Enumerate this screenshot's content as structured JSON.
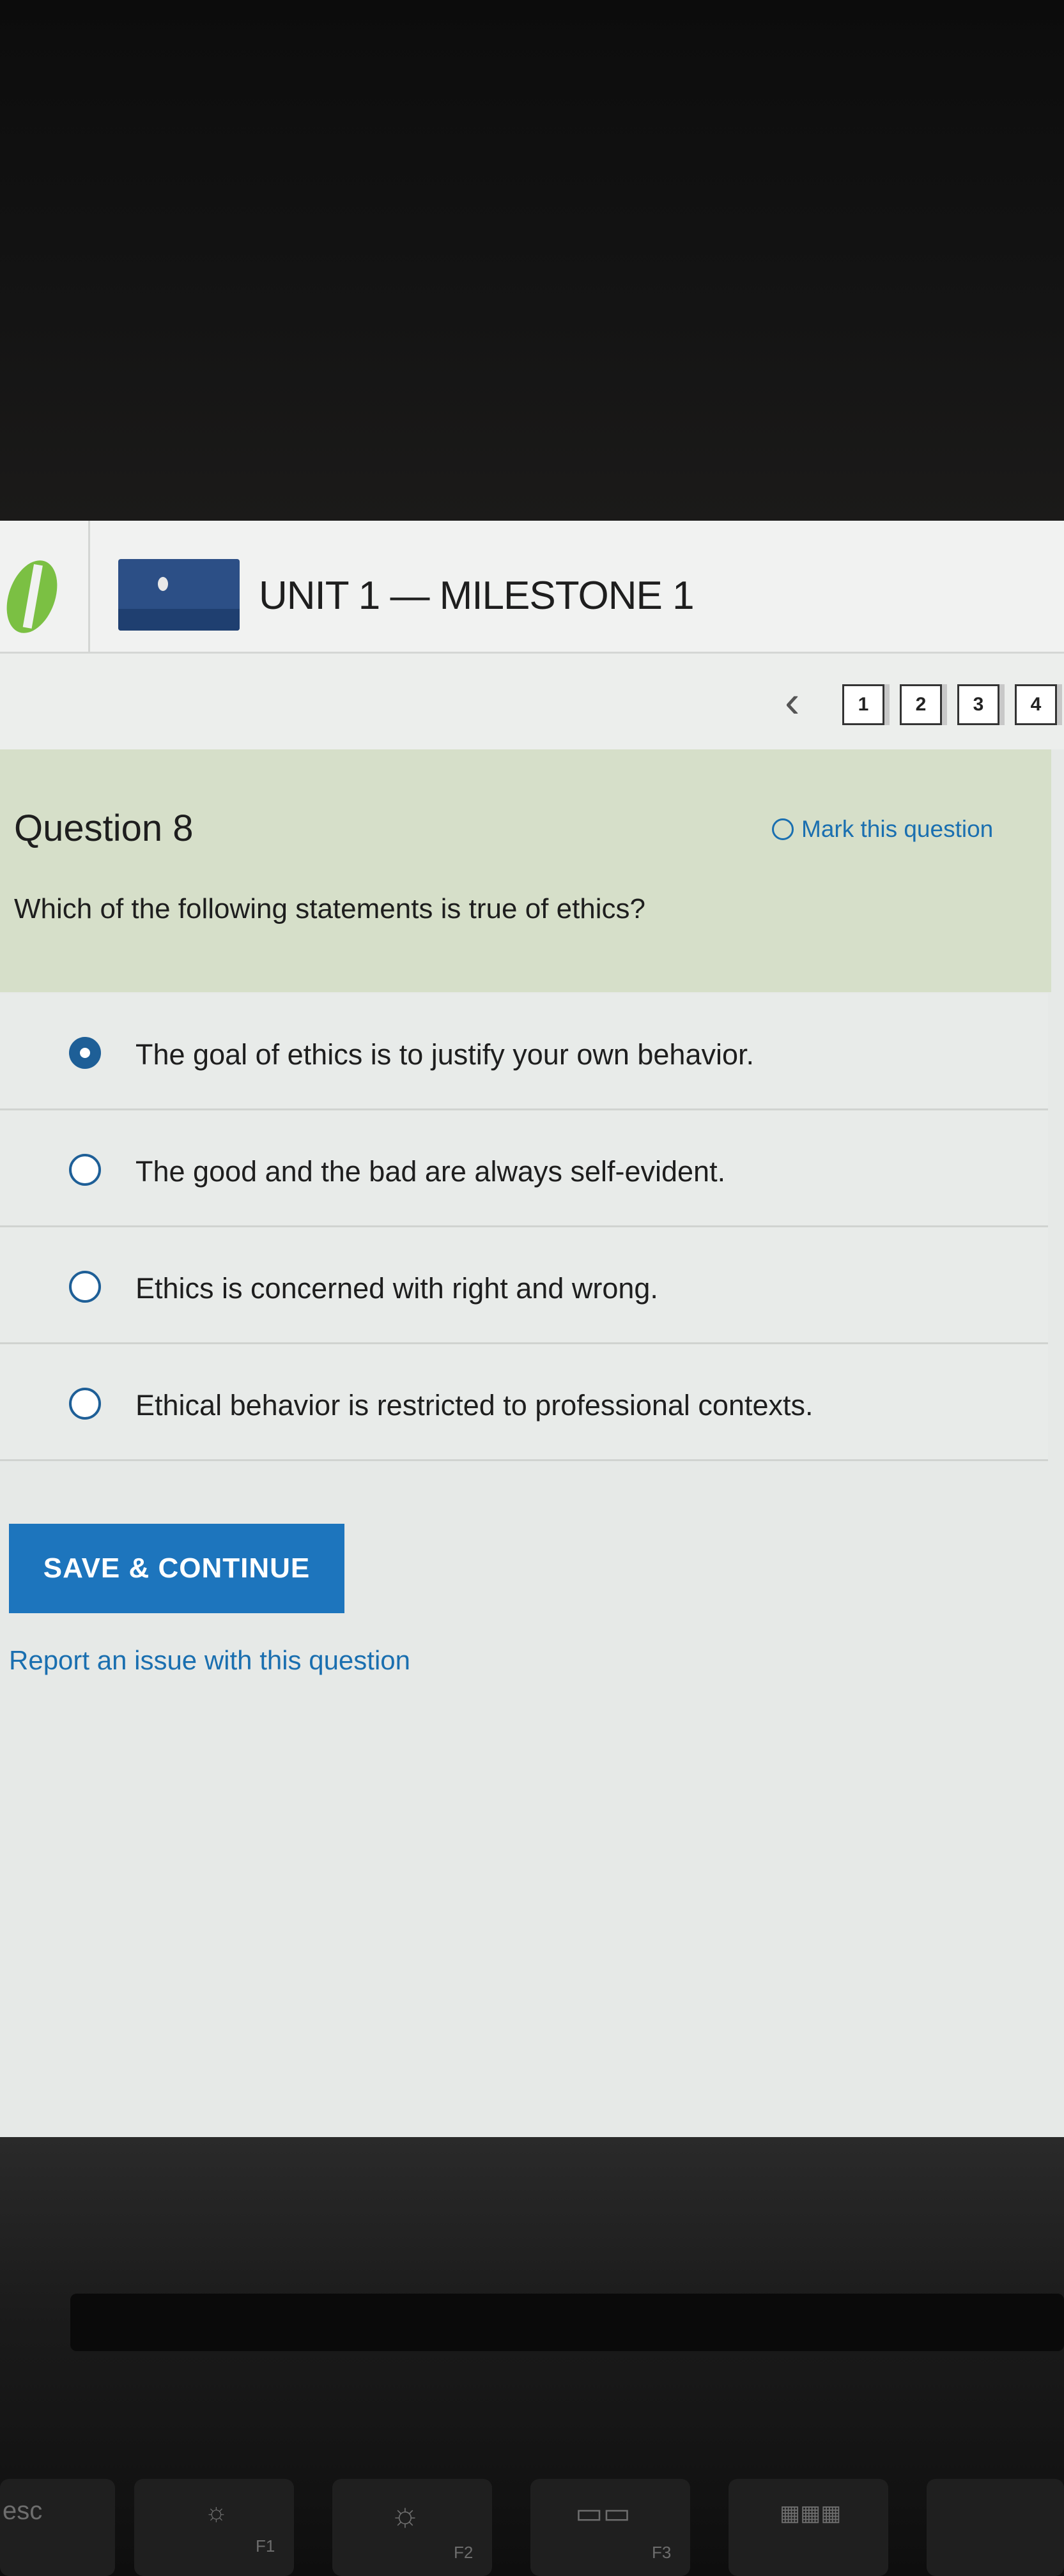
{
  "header": {
    "unit_title": "UNIT 1 — MILESTONE 1"
  },
  "question_nav": {
    "back_icon": "chevron-left-icon",
    "numbers": [
      "1",
      "2",
      "3",
      "4"
    ]
  },
  "question": {
    "number_label": "Question 8",
    "mark_label": "Mark this question",
    "prompt": "Which of the following statements is true of ethics?"
  },
  "answers": [
    {
      "text": "The goal of ethics is to justify your own behavior.",
      "selected": true
    },
    {
      "text": "The good and the bad are always self-evident.",
      "selected": false
    },
    {
      "text": "Ethics is concerned with right and wrong.",
      "selected": false
    },
    {
      "text": "Ethical behavior is restricted to professional contexts.",
      "selected": false
    }
  ],
  "actions": {
    "save_label": "SAVE & CONTINUE",
    "report_label": "Report an issue with this question"
  },
  "keyboard": {
    "esc": "esc",
    "f1": "F1",
    "f2": "F2",
    "f3": "F3"
  },
  "colors": {
    "accent": "#1d75bd",
    "link": "#1a6fb0",
    "question_header_bg": "#d6dfc9",
    "logo": "#7bc043"
  }
}
